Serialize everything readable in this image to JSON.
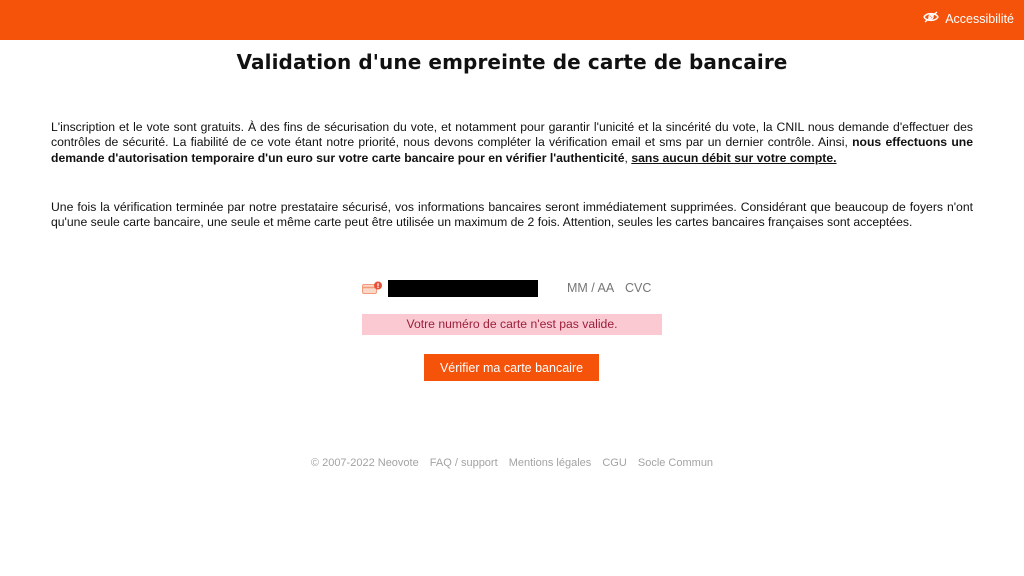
{
  "header": {
    "accessibility_label": "Accessibilité",
    "accent_color": "#f5520a"
  },
  "page": {
    "title": "Validation d'une empreinte de carte de bancaire"
  },
  "intro": {
    "p1_text": "L'inscription et le vote sont gratuits. À des fins de sécurisation du vote, et notamment pour garantir l'unicité et la sincérité du vote, la CNIL nous demande d'effectuer des contrôles de sécurité. La fiabilité de ce vote étant notre priorité, nous devons compléter la vérification email et sms par un dernier contrôle. Ainsi, ",
    "p1_bold": "nous effectuons une demande d'autorisation temporaire d'un euro sur votre carte bancaire pour en vérifier l'authenticité",
    "p1_sep": ", ",
    "p1_underline": "sans aucun débit sur votre compte.",
    "p2_text": "Une fois la vérification terminée par notre prestataire sécurisé, vos informations bancaires seront immédiatement supprimées. Considérant que beaucoup de foyers n'ont qu'une seule carte bancaire, une seule et même carte peut être utilisée un maximum de 2 fois. Attention, seules les cartes bancaires françaises sont acceptées."
  },
  "card_form": {
    "card_icon": "card-error-icon",
    "number_value": "",
    "expiry_placeholder": "MM / AA",
    "cvc_placeholder": "CVC",
    "error_message": "Votre numéro de carte n'est pas valide.",
    "error_bg": "#fbc9d2",
    "error_color": "#9b1f3b"
  },
  "actions": {
    "verify_label": "Vérifier ma carte bancaire"
  },
  "footer": {
    "copyright": "© 2007-2022 Neovote",
    "links": [
      "FAQ / support",
      "Mentions légales",
      "CGU",
      "Socle Commun"
    ]
  }
}
